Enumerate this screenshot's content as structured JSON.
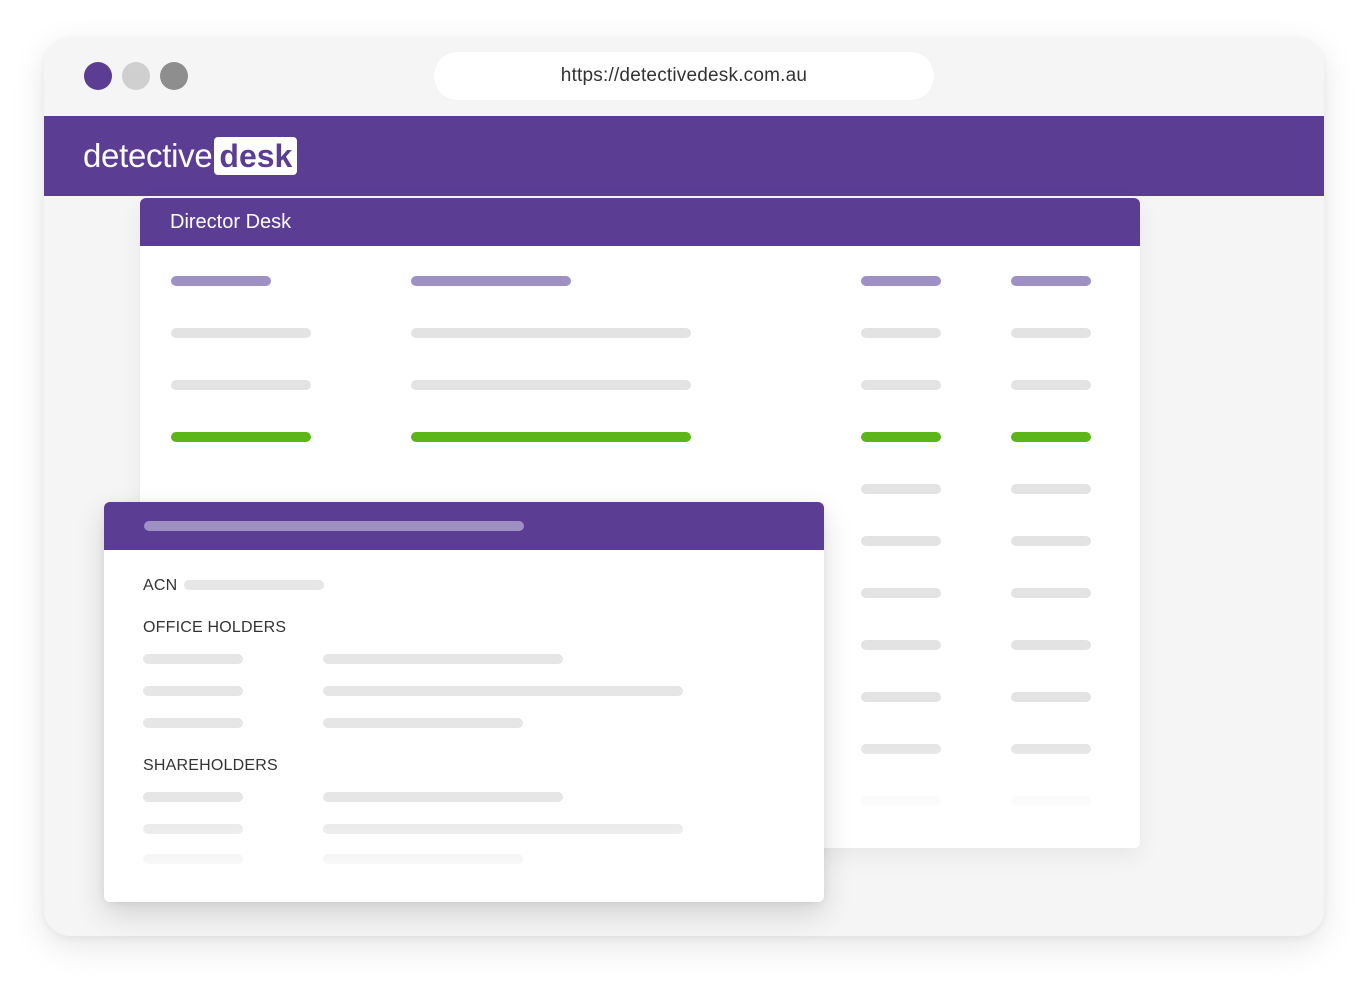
{
  "browser": {
    "url": "https://detectivedesk.com.au",
    "controls": [
      "close-dot",
      "minimize-dot",
      "maximize-dot"
    ]
  },
  "brand": {
    "name_part1": "detective",
    "name_part2": "desk",
    "color": "#5b3d94"
  },
  "director_panel": {
    "title": "Director Desk",
    "accent_colors": {
      "header_placeholder": "#9e90c2",
      "highlight_row": "#5cb61a",
      "placeholder": "#e3e3e3"
    }
  },
  "company_card": {
    "acn_label": "ACN",
    "office_holders_label": "OFFICE HOLDERS",
    "shareholders_label": "SHAREHOLDERS"
  }
}
